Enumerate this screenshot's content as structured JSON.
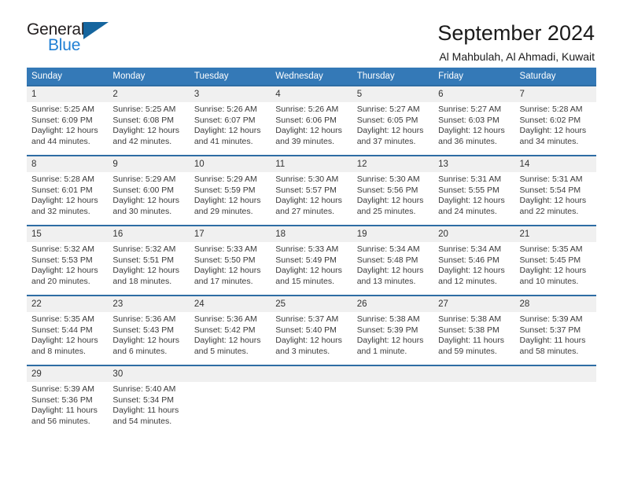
{
  "brand": {
    "logo_primary": "General",
    "logo_secondary": "Blue",
    "accent_color": "#15659e",
    "blue_text_color": "#1f7fd4"
  },
  "header": {
    "title": "September 2024",
    "subtitle": "Al Mahbulah, Al Ahmadi, Kuwait"
  },
  "theme": {
    "header_row_bg": "#3479b7",
    "cell_top_border": "#2e6da4",
    "daynum_bg": "#f0f0f0"
  },
  "weekday_headers": [
    "Sunday",
    "Monday",
    "Tuesday",
    "Wednesday",
    "Thursday",
    "Friday",
    "Saturday"
  ],
  "weeks": [
    [
      {
        "day": "1",
        "info": "Sunrise: 5:25 AM\nSunset: 6:09 PM\nDaylight: 12 hours\nand 44 minutes."
      },
      {
        "day": "2",
        "info": "Sunrise: 5:25 AM\nSunset: 6:08 PM\nDaylight: 12 hours\nand 42 minutes."
      },
      {
        "day": "3",
        "info": "Sunrise: 5:26 AM\nSunset: 6:07 PM\nDaylight: 12 hours\nand 41 minutes."
      },
      {
        "day": "4",
        "info": "Sunrise: 5:26 AM\nSunset: 6:06 PM\nDaylight: 12 hours\nand 39 minutes."
      },
      {
        "day": "5",
        "info": "Sunrise: 5:27 AM\nSunset: 6:05 PM\nDaylight: 12 hours\nand 37 minutes."
      },
      {
        "day": "6",
        "info": "Sunrise: 5:27 AM\nSunset: 6:03 PM\nDaylight: 12 hours\nand 36 minutes."
      },
      {
        "day": "7",
        "info": "Sunrise: 5:28 AM\nSunset: 6:02 PM\nDaylight: 12 hours\nand 34 minutes."
      }
    ],
    [
      {
        "day": "8",
        "info": "Sunrise: 5:28 AM\nSunset: 6:01 PM\nDaylight: 12 hours\nand 32 minutes."
      },
      {
        "day": "9",
        "info": "Sunrise: 5:29 AM\nSunset: 6:00 PM\nDaylight: 12 hours\nand 30 minutes."
      },
      {
        "day": "10",
        "info": "Sunrise: 5:29 AM\nSunset: 5:59 PM\nDaylight: 12 hours\nand 29 minutes."
      },
      {
        "day": "11",
        "info": "Sunrise: 5:30 AM\nSunset: 5:57 PM\nDaylight: 12 hours\nand 27 minutes."
      },
      {
        "day": "12",
        "info": "Sunrise: 5:30 AM\nSunset: 5:56 PM\nDaylight: 12 hours\nand 25 minutes."
      },
      {
        "day": "13",
        "info": "Sunrise: 5:31 AM\nSunset: 5:55 PM\nDaylight: 12 hours\nand 24 minutes."
      },
      {
        "day": "14",
        "info": "Sunrise: 5:31 AM\nSunset: 5:54 PM\nDaylight: 12 hours\nand 22 minutes."
      }
    ],
    [
      {
        "day": "15",
        "info": "Sunrise: 5:32 AM\nSunset: 5:53 PM\nDaylight: 12 hours\nand 20 minutes."
      },
      {
        "day": "16",
        "info": "Sunrise: 5:32 AM\nSunset: 5:51 PM\nDaylight: 12 hours\nand 18 minutes."
      },
      {
        "day": "17",
        "info": "Sunrise: 5:33 AM\nSunset: 5:50 PM\nDaylight: 12 hours\nand 17 minutes."
      },
      {
        "day": "18",
        "info": "Sunrise: 5:33 AM\nSunset: 5:49 PM\nDaylight: 12 hours\nand 15 minutes."
      },
      {
        "day": "19",
        "info": "Sunrise: 5:34 AM\nSunset: 5:48 PM\nDaylight: 12 hours\nand 13 minutes."
      },
      {
        "day": "20",
        "info": "Sunrise: 5:34 AM\nSunset: 5:46 PM\nDaylight: 12 hours\nand 12 minutes."
      },
      {
        "day": "21",
        "info": "Sunrise: 5:35 AM\nSunset: 5:45 PM\nDaylight: 12 hours\nand 10 minutes."
      }
    ],
    [
      {
        "day": "22",
        "info": "Sunrise: 5:35 AM\nSunset: 5:44 PM\nDaylight: 12 hours\nand 8 minutes."
      },
      {
        "day": "23",
        "info": "Sunrise: 5:36 AM\nSunset: 5:43 PM\nDaylight: 12 hours\nand 6 minutes."
      },
      {
        "day": "24",
        "info": "Sunrise: 5:36 AM\nSunset: 5:42 PM\nDaylight: 12 hours\nand 5 minutes."
      },
      {
        "day": "25",
        "info": "Sunrise: 5:37 AM\nSunset: 5:40 PM\nDaylight: 12 hours\nand 3 minutes."
      },
      {
        "day": "26",
        "info": "Sunrise: 5:38 AM\nSunset: 5:39 PM\nDaylight: 12 hours\nand 1 minute."
      },
      {
        "day": "27",
        "info": "Sunrise: 5:38 AM\nSunset: 5:38 PM\nDaylight: 11 hours\nand 59 minutes."
      },
      {
        "day": "28",
        "info": "Sunrise: 5:39 AM\nSunset: 5:37 PM\nDaylight: 11 hours\nand 58 minutes."
      }
    ],
    [
      {
        "day": "29",
        "info": "Sunrise: 5:39 AM\nSunset: 5:36 PM\nDaylight: 11 hours\nand 56 minutes."
      },
      {
        "day": "30",
        "info": "Sunrise: 5:40 AM\nSunset: 5:34 PM\nDaylight: 11 hours\nand 54 minutes."
      },
      {
        "day": "",
        "info": ""
      },
      {
        "day": "",
        "info": ""
      },
      {
        "day": "",
        "info": ""
      },
      {
        "day": "",
        "info": ""
      },
      {
        "day": "",
        "info": ""
      }
    ]
  ]
}
